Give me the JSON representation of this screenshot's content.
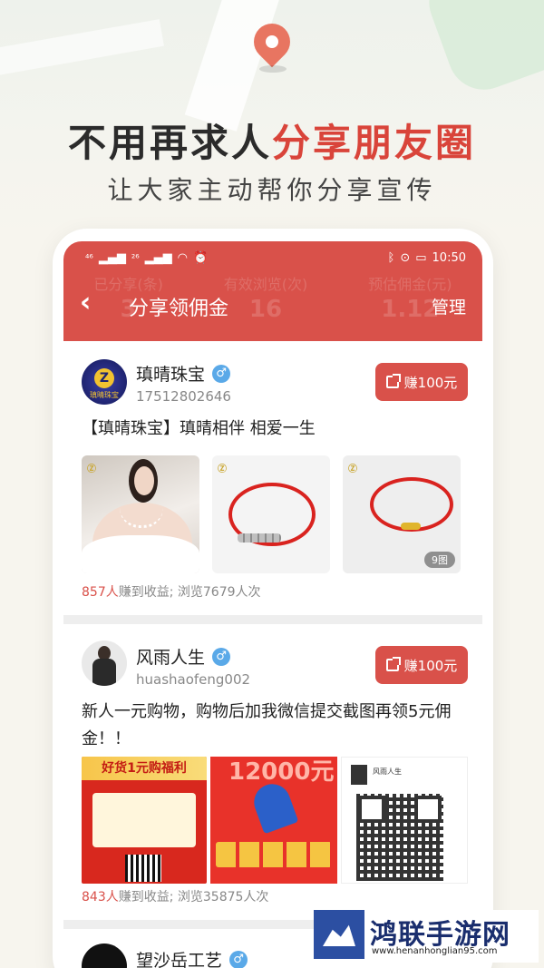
{
  "banner": {
    "headline_part1": "不用再求人",
    "headline_part2": "分享朋友圈",
    "subline": "让大家主动帮你分享宣传",
    "accent": "#d9443a"
  },
  "status_bar": {
    "sig1": "⁴⁶",
    "sig2": "²⁶",
    "time": "10:50"
  },
  "appbar": {
    "title": "分享领佣金",
    "manage_label": "管理",
    "bg_color": "#d9514a",
    "ghost_stats": [
      {
        "label": "已分享(条)",
        "value": "3"
      },
      {
        "label": "有效浏览(次)",
        "value": "16"
      },
      {
        "label": "预估佣金(元)",
        "value": "1.12"
      }
    ]
  },
  "posts": [
    {
      "username": "瑱晴珠宝",
      "user_id": "17512802646",
      "earn_label": "赚100元",
      "text": "【瑱晴珠宝】瑱晴相伴 相爱一生",
      "image_count_badge": "9图",
      "earners": "857人",
      "stats_rest": "赚到收益; 浏览7679人次",
      "avatar_text": "瑱晴珠宝"
    },
    {
      "username": "风雨人生",
      "user_id": "huashaofeng002",
      "earn_label": "赚100元",
      "text": "新人一元购物，购物后加我微信提交截图再领5元佣金！！",
      "promo1_title": "好货1元购福利",
      "promo2_text": "12000元",
      "promo3_name": "风雨人生",
      "earners": "843人",
      "stats_rest": "赚到收益; 浏览35875人次"
    },
    {
      "username": "望沙岳工艺"
    }
  ],
  "site_badge": {
    "title": "鸿联手游网",
    "url": "www.henanhonglian95.com"
  }
}
